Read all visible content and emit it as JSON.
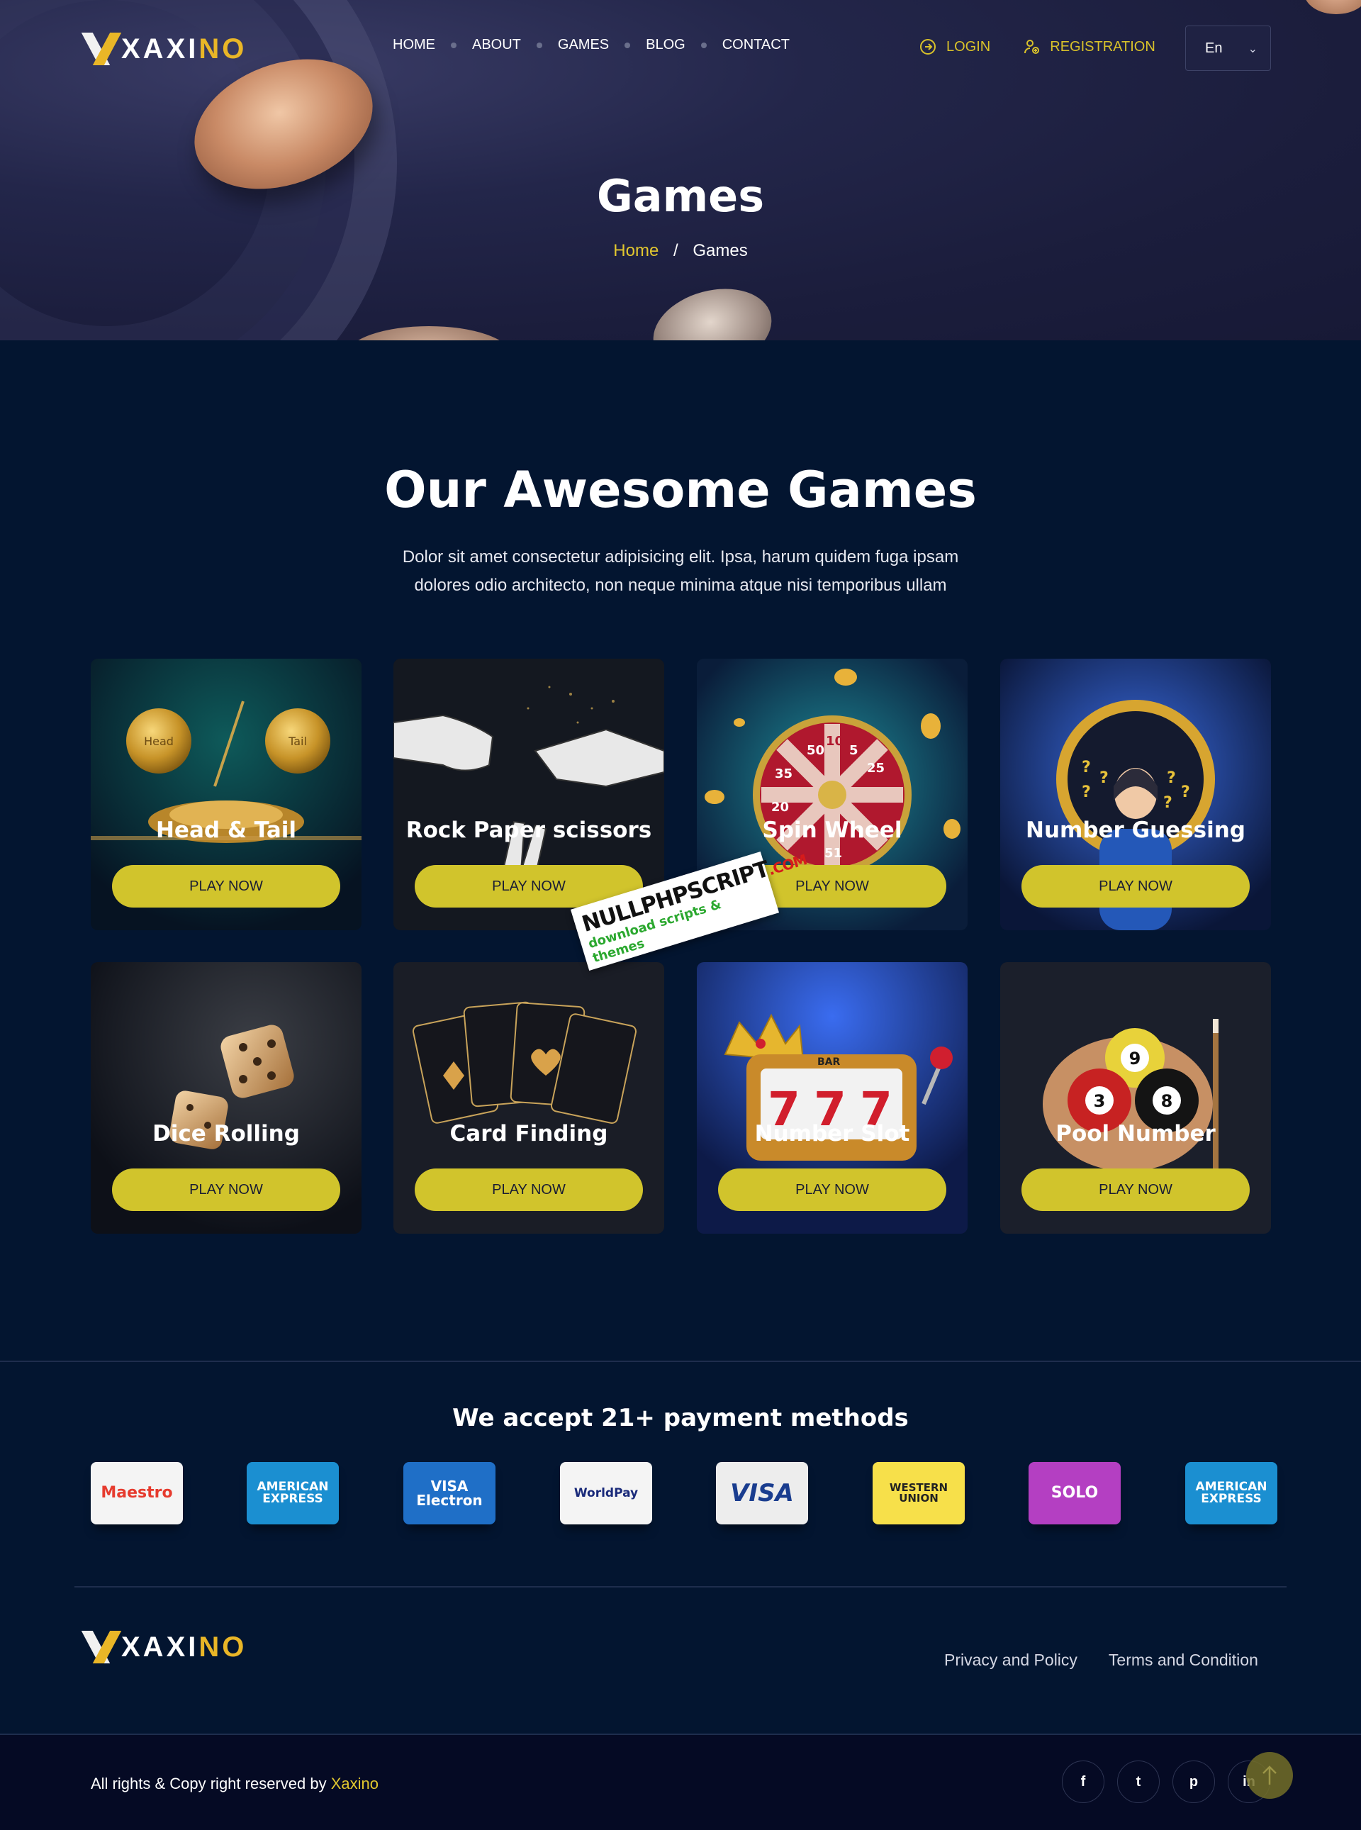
{
  "brand": {
    "logo_white": "XAXI",
    "logo_yellow": "NO",
    "accent": "#d1c42c",
    "gold": "#e9b627"
  },
  "nav": {
    "items": [
      {
        "label": "HOME"
      },
      {
        "label": "ABOUT"
      },
      {
        "label": "GAMES"
      },
      {
        "label": "BLOG"
      },
      {
        "label": "CONTACT"
      }
    ],
    "login": "LOGIN",
    "registration": "REGISTRATION",
    "language": "En"
  },
  "hero": {
    "title": "Games",
    "breadcrumb_home": "Home",
    "breadcrumb_sep": "/",
    "breadcrumb_current": "Games"
  },
  "section": {
    "title": "Our Awesome Games",
    "description": "Dolor sit amet consectetur adipisicing elit. Ipsa, harum quidem fuga ipsam dolores odio architecto, non neque minima atque nisi temporibus ullam"
  },
  "games": [
    {
      "name": "Head & Tail",
      "button": "PLAY NOW",
      "icon": "coin-icon"
    },
    {
      "name": "Rock Paper scissors",
      "button": "PLAY NOW",
      "icon": "hand-icon"
    },
    {
      "name": "Spin Wheel",
      "button": "PLAY NOW",
      "icon": "wheel-icon"
    },
    {
      "name": "Number Guessing",
      "button": "PLAY NOW",
      "icon": "question-icon"
    },
    {
      "name": "Dice Rolling",
      "button": "PLAY NOW",
      "icon": "dice-icon"
    },
    {
      "name": "Card Finding",
      "button": "PLAY NOW",
      "icon": "cards-icon"
    },
    {
      "name": "Number Slot",
      "button": "PLAY NOW",
      "icon": "slot-icon"
    },
    {
      "name": "Pool Number",
      "button": "PLAY NOW",
      "icon": "pool-ball-icon"
    }
  ],
  "game_art_text": {
    "coin_left": "Head",
    "coin_right": "Tail",
    "wheel_numbers": [
      "50",
      "10",
      "5",
      "25",
      "35",
      "20",
      "51"
    ],
    "slot_reels": [
      "7",
      "7",
      "7"
    ],
    "slot_bar": "BAR",
    "pool_balls": [
      "9",
      "3",
      "8"
    ]
  },
  "watermark": {
    "line1": "NULLPHPSCRIPT",
    "suffix": ".COM",
    "line2": "download scripts & themes"
  },
  "payments": {
    "title": "We accept 21+ payment methods",
    "methods": [
      {
        "name": "Maestro",
        "bg": "#f4f4f4",
        "fg": "#e63b2e"
      },
      {
        "name": "AMERICAN EXPRESS",
        "bg": "#1b8fd1",
        "fg": "#ffffff"
      },
      {
        "name": "VISA Electron",
        "bg": "#1f6fc7",
        "fg": "#ffffff"
      },
      {
        "name": "WorldPay",
        "bg": "#f4f4f4",
        "fg": "#1a2a7a"
      },
      {
        "name": "VISA",
        "bg": "#ededed",
        "fg": "#1a3d8f"
      },
      {
        "name": "WESTERN UNION",
        "bg": "#f7e04a",
        "fg": "#222222"
      },
      {
        "name": "SOLO",
        "bg": "#b43fc2",
        "fg": "#ffffff"
      },
      {
        "name": "AMERICAN EXPRESS",
        "bg": "#1b8fd1",
        "fg": "#ffffff"
      }
    ]
  },
  "footer": {
    "privacy": "Privacy and Policy",
    "terms": "Terms and Condition",
    "copyright": "All rights & Copy right reserved by",
    "copyright_brand": "Xaxino",
    "socials": [
      {
        "name": "facebook",
        "glyph": "f"
      },
      {
        "name": "twitter",
        "glyph": "t"
      },
      {
        "name": "pinterest",
        "glyph": "p"
      },
      {
        "name": "linkedin",
        "glyph": "in"
      }
    ]
  }
}
